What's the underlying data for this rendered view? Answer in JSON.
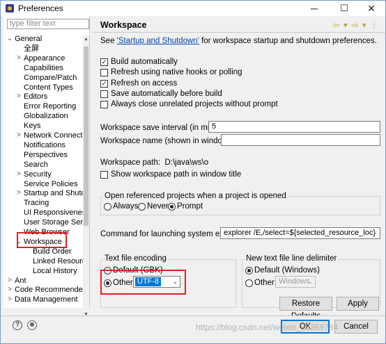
{
  "window": {
    "title": "Preferences",
    "minimize": "─",
    "maximize": "☐",
    "close": "✕"
  },
  "sidebar": {
    "filter_placeholder": "type filter text",
    "items": [
      {
        "label": "General",
        "twisty": "⌄"
      },
      {
        "label": "全屏"
      },
      {
        "label": "Appearance",
        "twisty": ">"
      },
      {
        "label": "Capabilities"
      },
      {
        "label": "Compare/Patch"
      },
      {
        "label": "Content Types"
      },
      {
        "label": "Editors",
        "twisty": ">"
      },
      {
        "label": "Error Reporting"
      },
      {
        "label": "Globalization"
      },
      {
        "label": "Keys"
      },
      {
        "label": "Network Connectio",
        "twisty": ">"
      },
      {
        "label": "Notifications"
      },
      {
        "label": "Perspectives"
      },
      {
        "label": "Search"
      },
      {
        "label": "Security",
        "twisty": ">"
      },
      {
        "label": "Service Policies"
      },
      {
        "label": "Startup and Shutd",
        "twisty": ">"
      },
      {
        "label": "Tracing"
      },
      {
        "label": "UI Responsivenes"
      },
      {
        "label": "User Storage Serv"
      },
      {
        "label": "Web Browser"
      },
      {
        "label": "Workspace",
        "twisty": "⌄"
      },
      {
        "label": "Build Order"
      },
      {
        "label": "Linked Resourc"
      },
      {
        "label": "Local History"
      },
      {
        "label": "Ant",
        "twisty": ">"
      },
      {
        "label": "Code Recommenders",
        "twisty": ">"
      },
      {
        "label": "Data Management",
        "twisty": ">"
      }
    ]
  },
  "main": {
    "title": "Workspace",
    "nav_icons": "⇦ ▾ ⇨ ▾ ⋮",
    "intro_pre": "See ",
    "intro_link": "'Startup and Shutdown'",
    "intro_post": " for workspace startup and shutdown preferences.",
    "options": [
      {
        "label": "Build automatically",
        "checked": true
      },
      {
        "label": "Refresh using native hooks or polling",
        "checked": false
      },
      {
        "label": "Refresh on access",
        "checked": true
      },
      {
        "label": "Save automatically before build",
        "checked": false
      },
      {
        "label": "Always close unrelated projects without prompt",
        "checked": false
      }
    ],
    "save_interval_label": "Workspace save interval (in minutes):",
    "save_interval_value": "5",
    "ws_name_label": "Workspace name (shown in window title):",
    "ws_name_value": "",
    "ws_path_label": "Workspace path:",
    "ws_path_value": "D:\\java\\ws\\o",
    "show_path_label": "Show workspace path in window title",
    "open_ref_label": "Open referenced projects when a project is opened",
    "open_ref_options": [
      "Always",
      "Never",
      "Prompt"
    ],
    "open_ref_selected": "Prompt",
    "explorer_label": "Command for launching system explorer:",
    "explorer_value": "explorer /E,/select=${selected_resource_loc}",
    "encoding": {
      "title": "Text file encoding",
      "default_label": "Default (GBK)",
      "other_label": "Other:",
      "other_value": "UTF-8",
      "selected": "Other"
    },
    "delimiter": {
      "title": "New text file line delimiter",
      "default_label": "Default (Windows)",
      "other_label": "Other:",
      "other_value": "Windows",
      "selected": "Default"
    },
    "restore_label": "Restore Defaults",
    "apply_label": "Apply"
  },
  "footer": {
    "help_icon": "?",
    "ok_label": "OK",
    "cancel_label": "Cancel",
    "watermark": "https://blog.csdn.net/weixin_36369784"
  },
  "highlight_color": "#e02020"
}
